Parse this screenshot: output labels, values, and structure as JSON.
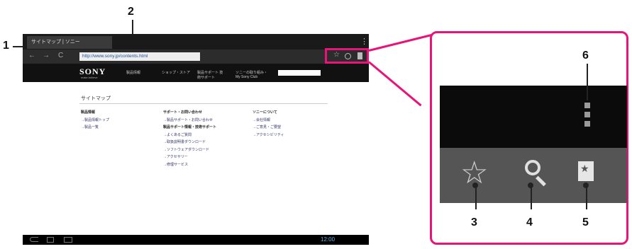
{
  "browser": {
    "tab_label": "サイトマップ | ソニー",
    "url": "http://www.sony.jp/contents.html",
    "back_glyph": "←",
    "forward_glyph": "→",
    "reload_glyph": "C",
    "star_glyph": "☆",
    "search_glyph": "🔍",
    "bookmark_glyph": "▮",
    "menu_glyph": "⋮"
  },
  "page": {
    "logo": "SONY",
    "logo_sub": "make.believe",
    "nav": [
      "製品情報",
      "ショップ・ストア",
      "製品サポート 技術サポート",
      "ソニーの取り組み・My Sony Club"
    ],
    "title": "サイトマップ",
    "columns": [
      {
        "head": "製品情報",
        "items": [
          "→製品情報トップ",
          "→製品一覧"
        ]
      },
      {
        "head": "サポート・お問い合わせ",
        "items": [
          "→製品サポート・お問い合わせ",
          "製品サポート情報・技術サポート",
          "→よくあるご質問",
          "→取扱説明書ダウンロード",
          "→ソフトウェアダウンロード",
          "→アクセサリー",
          "→修理サービス"
        ]
      },
      {
        "head": "ソニーについて",
        "items": [
          "→会社情報",
          "→ご意見・ご要望",
          "→アクセシビリティ"
        ]
      }
    ]
  },
  "statusbar": {
    "clock": "12:00"
  },
  "callouts": [
    "1",
    "2",
    "3",
    "4",
    "5",
    "6"
  ]
}
